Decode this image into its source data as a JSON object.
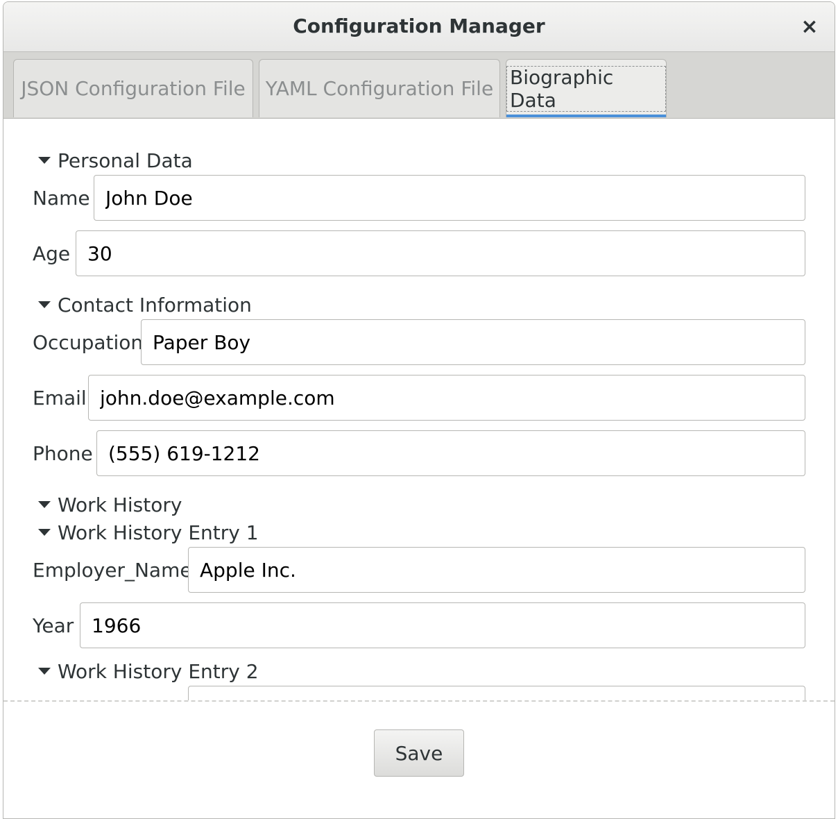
{
  "window": {
    "title": "Configuration Manager",
    "close_glyph": "×"
  },
  "tabs": [
    {
      "label": "JSON Configuration File",
      "active": false
    },
    {
      "label": "YAML Configuration File",
      "active": false
    },
    {
      "label": "Biographic Data",
      "active": true
    }
  ],
  "personal": {
    "header": "Personal Data",
    "name_label": "Name",
    "name_value": "John Doe",
    "age_label": "Age",
    "age_value": "30"
  },
  "contact": {
    "header": "Contact Information",
    "occupation_label": "Occupation",
    "occupation_value": "Paper Boy",
    "email_label": "Email",
    "email_value": "john.doe@example.com",
    "phone_label": "Phone",
    "phone_value": "(555) 619-1212"
  },
  "work": {
    "header": "Work History",
    "entry1": {
      "header": "Work History Entry 1",
      "employer_label": "Employer_Name",
      "employer_value": "Apple Inc.",
      "year_label": "Year",
      "year_value": "1966"
    },
    "entry2": {
      "header": "Work History Entry 2"
    }
  },
  "actions": {
    "save_label": "Save"
  },
  "colors": {
    "accent": "#4a90d9"
  }
}
